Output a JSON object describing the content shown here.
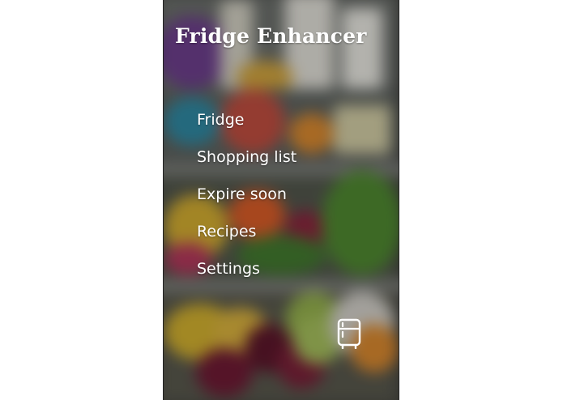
{
  "app": {
    "title": "Fridge Enhancer"
  },
  "menu": {
    "items": [
      {
        "id": "fridge",
        "label": "Fridge"
      },
      {
        "id": "shopping-list",
        "label": "Shopping list"
      },
      {
        "id": "expire-soon",
        "label": "Expire soon"
      },
      {
        "id": "recipes",
        "label": "Recipes"
      },
      {
        "id": "settings",
        "label": "Settings"
      }
    ]
  },
  "fab": {
    "icon": "fridge-icon"
  },
  "colors": {
    "text": "#ffffff",
    "background_tint": "#3a3a38"
  }
}
